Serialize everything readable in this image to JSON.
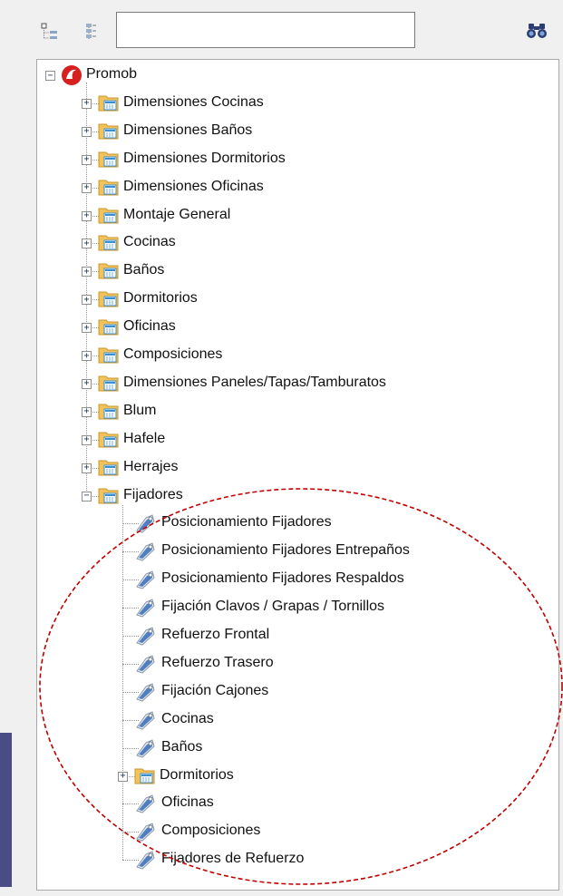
{
  "search": {
    "value": "",
    "placeholder": ""
  },
  "tree": {
    "root": {
      "label": "Promob",
      "expanded": true,
      "icon": "promob-logo-icon"
    },
    "children": [
      {
        "label": "Dimensiones Cocinas",
        "type": "folder",
        "expanded": false
      },
      {
        "label": "Dimensiones Baños",
        "type": "folder",
        "expanded": false
      },
      {
        "label": "Dimensiones Dormitorios",
        "type": "folder",
        "expanded": false
      },
      {
        "label": "Dimensiones Oficinas",
        "type": "folder",
        "expanded": false
      },
      {
        "label": "Montaje General",
        "type": "folder",
        "expanded": false
      },
      {
        "label": "Cocinas",
        "type": "folder",
        "expanded": false
      },
      {
        "label": "Baños",
        "type": "folder",
        "expanded": false
      },
      {
        "label": "Dormitorios",
        "type": "folder",
        "expanded": false
      },
      {
        "label": "Oficinas",
        "type": "folder",
        "expanded": false
      },
      {
        "label": "Composiciones",
        "type": "folder",
        "expanded": false
      },
      {
        "label": "Dimensiones Paneles/Tapas/Tamburatos",
        "type": "folder",
        "expanded": false
      },
      {
        "label": "Blum",
        "type": "folder",
        "expanded": false
      },
      {
        "label": "Hafele",
        "type": "folder",
        "expanded": false
      },
      {
        "label": "Herrajes",
        "type": "folder",
        "expanded": false
      },
      {
        "label": "Fijadores",
        "type": "folder",
        "expanded": true,
        "children": [
          {
            "label": "Posicionamiento Fijadores",
            "type": "item"
          },
          {
            "label": "Posicionamiento Fijadores Entrepaños",
            "type": "item"
          },
          {
            "label": "Posicionamiento Fijadores Respaldos",
            "type": "item"
          },
          {
            "label": "Fijación Clavos / Grapas / Tornillos",
            "type": "item"
          },
          {
            "label": "Refuerzo Frontal",
            "type": "item"
          },
          {
            "label": "Refuerzo Trasero",
            "type": "item"
          },
          {
            "label": "Fijación Cajones",
            "type": "item"
          },
          {
            "label": "Cocinas",
            "type": "item"
          },
          {
            "label": "Baños",
            "type": "item"
          },
          {
            "label": "Dormitorios",
            "type": "folder",
            "expanded": false
          },
          {
            "label": "Oficinas",
            "type": "item"
          },
          {
            "label": "Composiciones",
            "type": "item"
          },
          {
            "label": "Fijadores de Refuerzo",
            "type": "item"
          }
        ]
      }
    ]
  },
  "colors": {
    "highlight_ellipse": "#c00000",
    "folder": "#f3c35a",
    "side_strip": "#4a4c86"
  }
}
